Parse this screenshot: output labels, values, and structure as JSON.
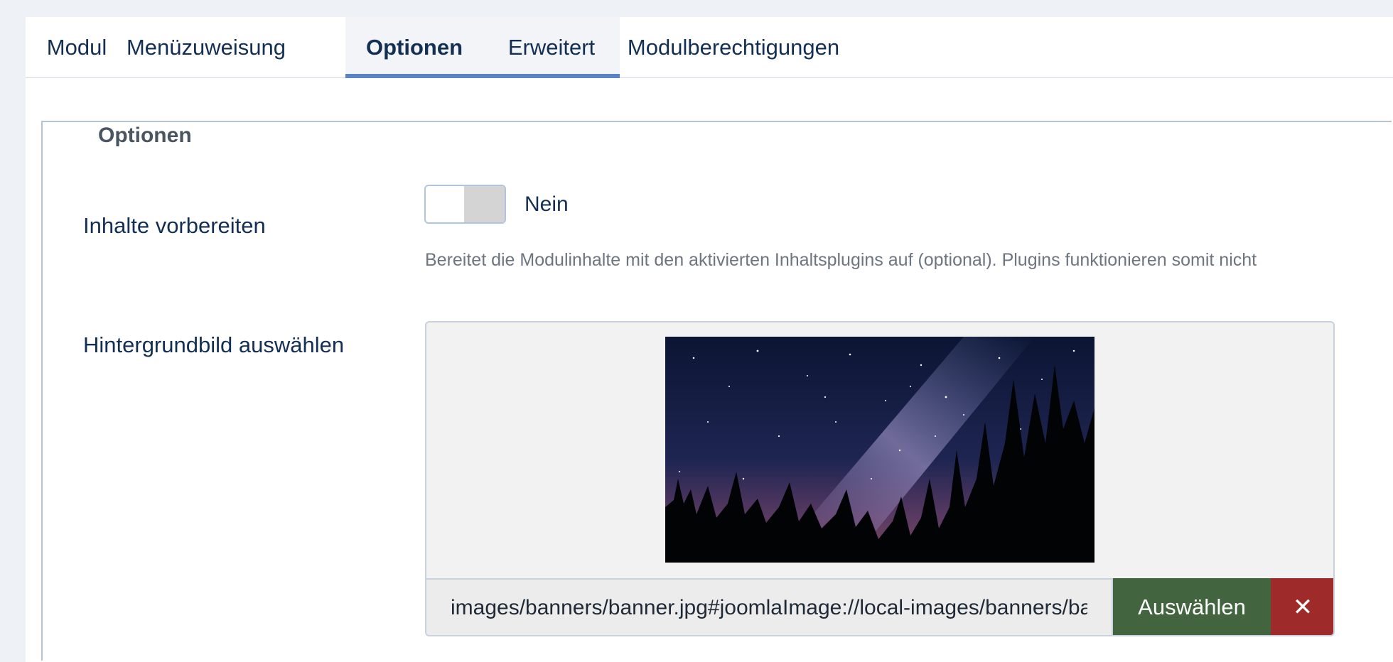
{
  "tabs": [
    {
      "label": "Modul",
      "active": false
    },
    {
      "label": "Menüzuweisung",
      "active": false
    },
    {
      "label": "Optionen",
      "active": true
    },
    {
      "label": "Erweitert",
      "active": false
    },
    {
      "label": "Modulberechtigungen",
      "active": false
    }
  ],
  "fieldset": {
    "legend": "Optionen"
  },
  "prepare_content": {
    "label": "Inhalte vorbereiten",
    "state": "Nein",
    "enabled": false,
    "help": "Bereitet die Modulinhalte mit den aktivierten Inhaltsplugins auf (optional). Plugins funktionieren somit nicht"
  },
  "background_image": {
    "label": "Hintergrundbild auswählen",
    "path_value": "images/banners/banner.jpg#joomlaImage://local-images/banners/banner.jpg",
    "select_label": "Auswählen",
    "clear_icon": "close-icon",
    "clear_glyph": "✕"
  },
  "colors": {
    "tab_active_underline": "#5a84c4",
    "select_button": "#42653f",
    "clear_button": "#9f2a2a",
    "text_primary": "#132f53"
  }
}
